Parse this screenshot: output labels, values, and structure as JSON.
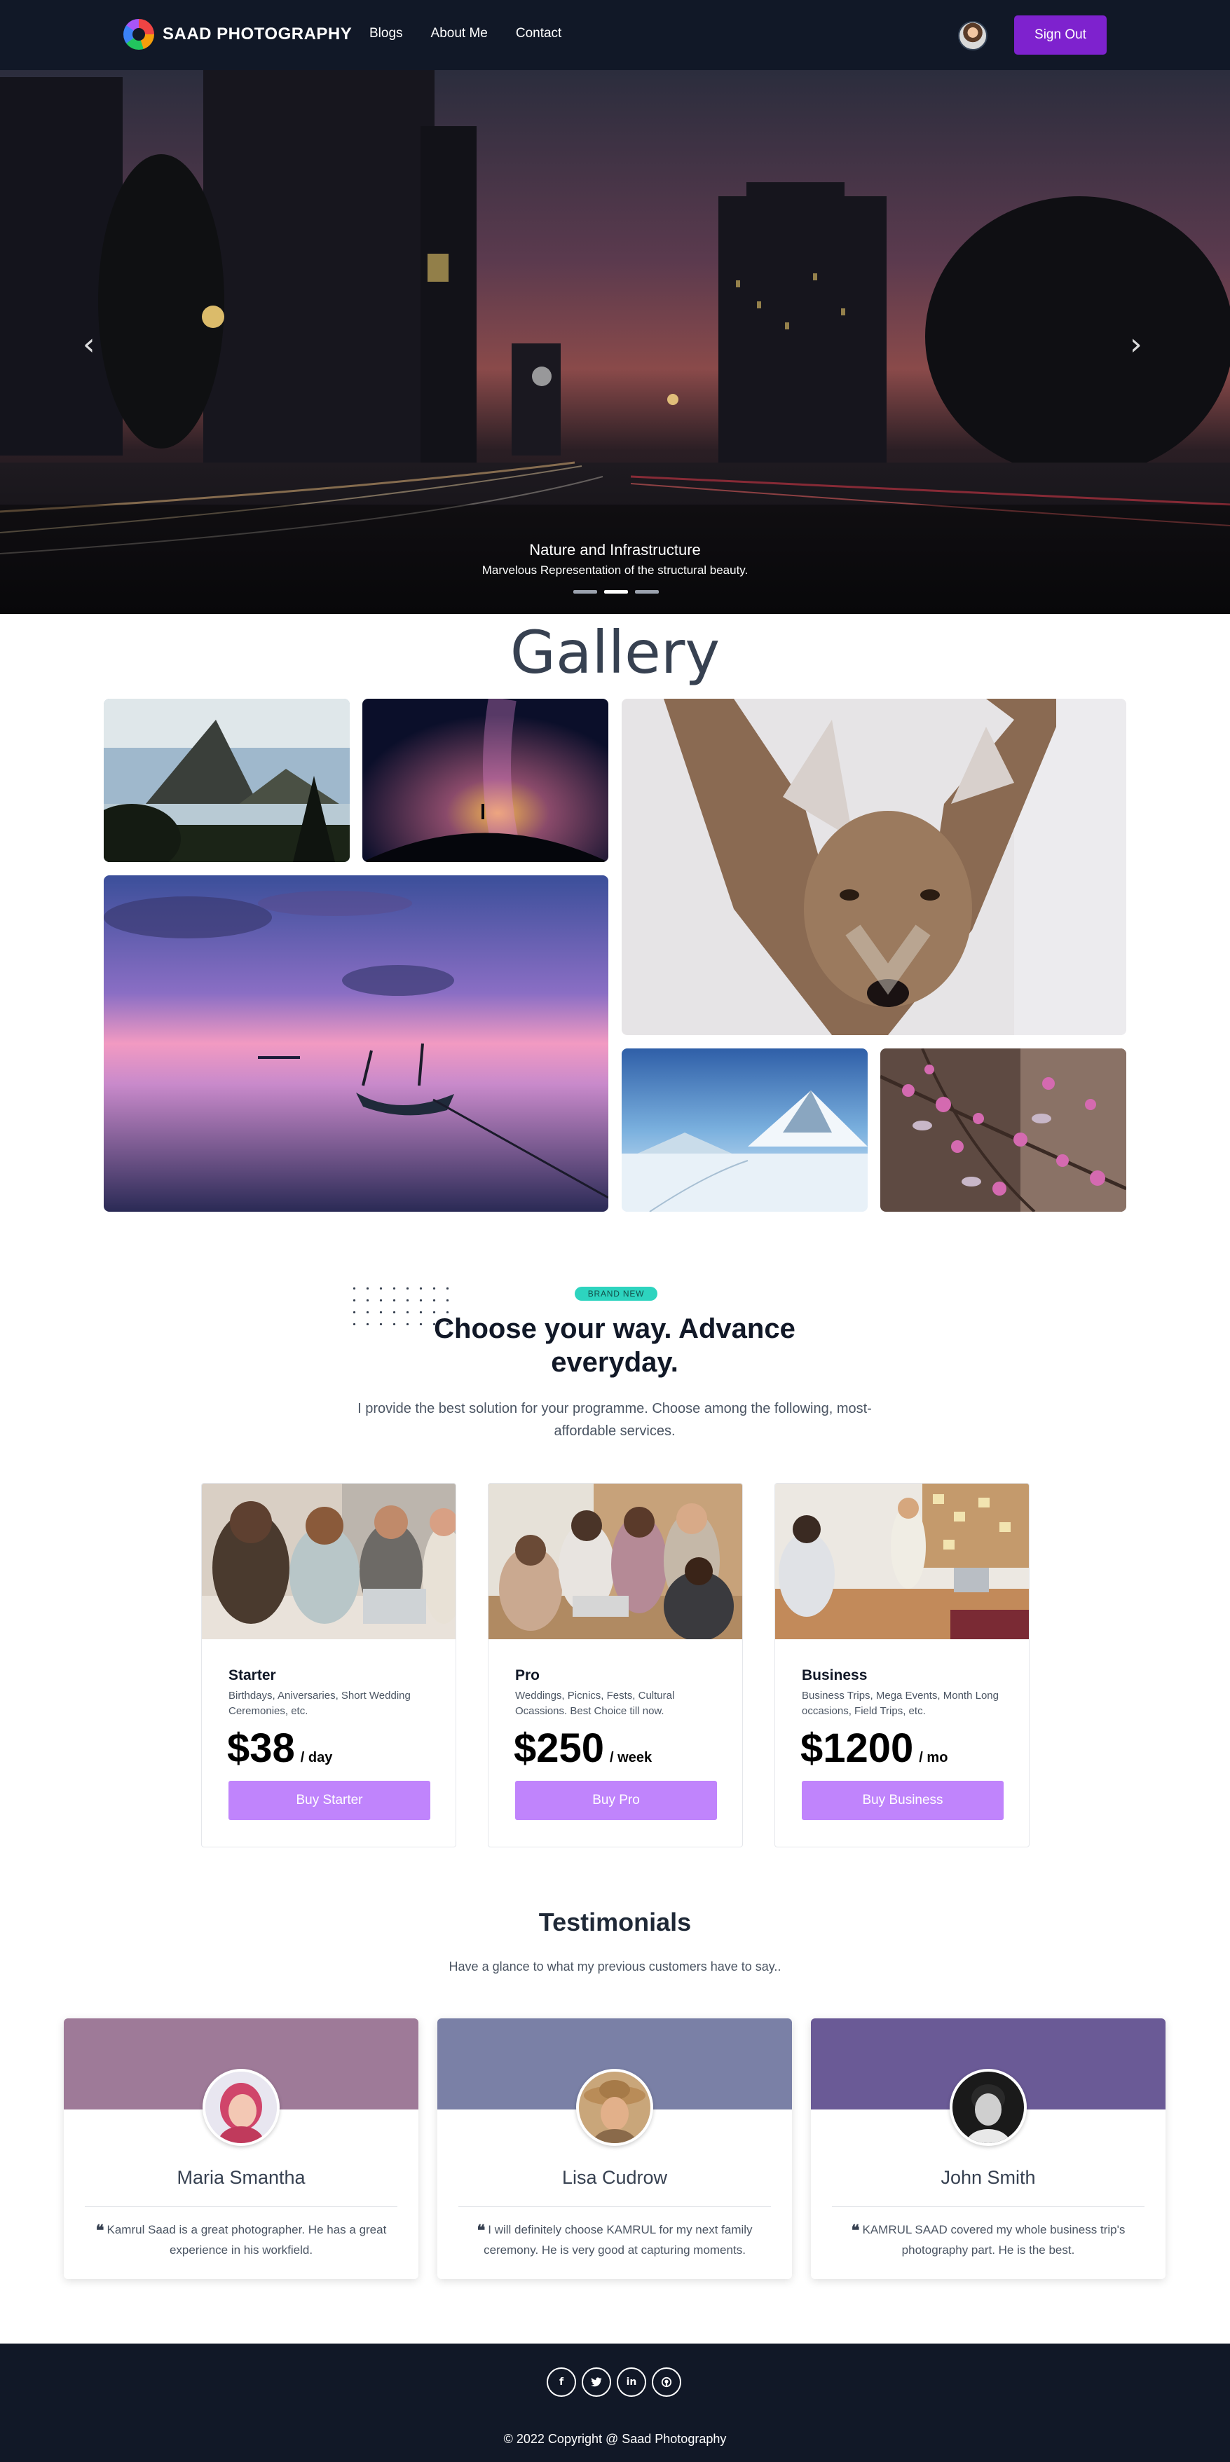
{
  "navbar": {
    "brand": "SAAD PHOTOGRAPHY",
    "links": [
      "Blogs",
      "About Me",
      "Contact"
    ],
    "signout_label": "Sign Out"
  },
  "hero": {
    "title": "Nature and Infrastructure",
    "subtitle": "Marvelous Representation of the structural beauty.",
    "prev_icon": "chevron-left-icon",
    "next_icon": "chevron-right-icon",
    "slides": 3,
    "active_slide": 2
  },
  "gallery": {
    "title": "Gallery",
    "photos": [
      "mountain-lake",
      "milky-way",
      "coyote",
      "sunset-boat",
      "snow-mountain",
      "pink-blossoms"
    ]
  },
  "pricing": {
    "badge": "BRAND NEW",
    "heading": "Choose your way. Advance everyday.",
    "subheading": "I provide the best solution for your programme. Choose among the following, most-affordable services.",
    "plans": [
      {
        "name": "Starter",
        "description": "Birthdays, Aniversaries, Short Wedding Ceremonies, etc.",
        "price": "$38",
        "period": "/ day",
        "button": "Buy Starter"
      },
      {
        "name": "Pro",
        "description": "Weddings, Picnics, Fests, Cultural Ocassions. Best Choice till now.",
        "price": "$250",
        "period": "/ week",
        "button": "Buy Pro"
      },
      {
        "name": "Business",
        "description": "Business Trips, Mega Events, Month Long occasions, Field Trips, etc.",
        "price": "$1200",
        "period": "/ mo",
        "button": "Buy Business"
      }
    ]
  },
  "testimonials": {
    "heading": "Testimonials",
    "subheading": "Have a glance to what my previous customers have to say..",
    "items": [
      {
        "name": "Maria Smantha",
        "quote": "Kamrul Saad is a great photographer. He has a great experience in his workfield.",
        "band_color": "#9e7a98"
      },
      {
        "name": "Lisa Cudrow",
        "quote": "I will definitely choose KAMRUL for my next family ceremony. He is very good at capturing moments.",
        "band_color": "#7a80a6"
      },
      {
        "name": "John Smith",
        "quote": "KAMRUL SAAD covered my whole business trip's photography part. He is the best.",
        "band_color": "#6a5a96"
      }
    ]
  },
  "footer": {
    "social": [
      "facebook-icon",
      "twitter-icon",
      "linkedin-icon",
      "github-icon"
    ],
    "copyright": "© 2022 Copyright @ Saad Photography"
  },
  "colors": {
    "navbar_bg": "#111827",
    "accent_purple": "#7e22ce",
    "plan_button": "#c084fc",
    "badge_teal": "#2dd4bf"
  }
}
